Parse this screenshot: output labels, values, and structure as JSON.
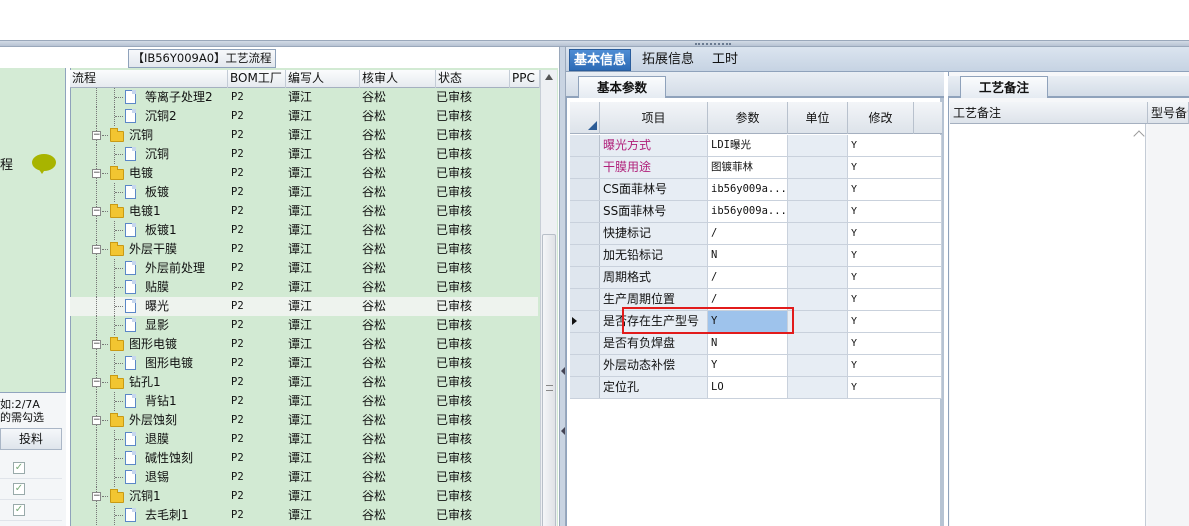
{
  "left_panel": {
    "flow_label": "程",
    "note_line1": " 如:2/7A",
    "note_line2": "的需勾选",
    "column_header": "投料",
    "checkbox_mark": "✓"
  },
  "process_panel": {
    "title": "【IB56Y009A0】工艺流程",
    "columns": [
      "流程",
      "BOM工厂",
      "编写人",
      "核审人",
      "状态",
      "PPC"
    ],
    "rows": [
      {
        "name": "等离子处理2",
        "level": 2,
        "type": "doc",
        "bom": "P2",
        "writer": "谭江",
        "reviewer": "谷松",
        "status": "已审核"
      },
      {
        "name": "沉铜2",
        "level": 2,
        "type": "doc",
        "bom": "P2",
        "writer": "谭江",
        "reviewer": "谷松",
        "status": "已审核"
      },
      {
        "name": "沉铜",
        "level": 1,
        "type": "folder",
        "bom": "P2",
        "writer": "谭江",
        "reviewer": "谷松",
        "status": "已审核"
      },
      {
        "name": "沉铜",
        "level": 2,
        "type": "doc",
        "bom": "P2",
        "writer": "谭江",
        "reviewer": "谷松",
        "status": "已审核"
      },
      {
        "name": "电镀",
        "level": 1,
        "type": "folder",
        "bom": "P2",
        "writer": "谭江",
        "reviewer": "谷松",
        "status": "已审核"
      },
      {
        "name": "板镀",
        "level": 2,
        "type": "doc",
        "bom": "P2",
        "writer": "谭江",
        "reviewer": "谷松",
        "status": "已审核"
      },
      {
        "name": "电镀1",
        "level": 1,
        "type": "folder",
        "bom": "P2",
        "writer": "谭江",
        "reviewer": "谷松",
        "status": "已审核"
      },
      {
        "name": "板镀1",
        "level": 2,
        "type": "doc",
        "bom": "P2",
        "writer": "谭江",
        "reviewer": "谷松",
        "status": "已审核"
      },
      {
        "name": "外层干膜",
        "level": 1,
        "type": "folder",
        "bom": "P2",
        "writer": "谭江",
        "reviewer": "谷松",
        "status": "已审核"
      },
      {
        "name": "外层前处理",
        "level": 2,
        "type": "doc",
        "bom": "P2",
        "writer": "谭江",
        "reviewer": "谷松",
        "status": "已审核"
      },
      {
        "name": "贴膜",
        "level": 2,
        "type": "doc",
        "bom": "P2",
        "writer": "谭江",
        "reviewer": "谷松",
        "status": "已审核"
      },
      {
        "name": "曝光",
        "level": 2,
        "type": "doc",
        "bom": "P2",
        "writer": "谭江",
        "reviewer": "谷松",
        "status": "已审核",
        "selected": true
      },
      {
        "name": "显影",
        "level": 2,
        "type": "doc",
        "bom": "P2",
        "writer": "谭江",
        "reviewer": "谷松",
        "status": "已审核"
      },
      {
        "name": "图形电镀",
        "level": 1,
        "type": "folder",
        "bom": "P2",
        "writer": "谭江",
        "reviewer": "谷松",
        "status": "已审核"
      },
      {
        "name": "图形电镀",
        "level": 2,
        "type": "doc",
        "bom": "P2",
        "writer": "谭江",
        "reviewer": "谷松",
        "status": "已审核"
      },
      {
        "name": "钻孔1",
        "level": 1,
        "type": "folder",
        "bom": "P2",
        "writer": "谭江",
        "reviewer": "谷松",
        "status": "已审核"
      },
      {
        "name": "背钻1",
        "level": 2,
        "type": "doc",
        "bom": "P2",
        "writer": "谭江",
        "reviewer": "谷松",
        "status": "已审核"
      },
      {
        "name": "外层蚀刻",
        "level": 1,
        "type": "folder",
        "bom": "P2",
        "writer": "谭江",
        "reviewer": "谷松",
        "status": "已审核"
      },
      {
        "name": "退膜",
        "level": 2,
        "type": "doc",
        "bom": "P2",
        "writer": "谭江",
        "reviewer": "谷松",
        "status": "已审核"
      },
      {
        "name": "碱性蚀刻",
        "level": 2,
        "type": "doc",
        "bom": "P2",
        "writer": "谭江",
        "reviewer": "谷松",
        "status": "已审核"
      },
      {
        "name": "退锡",
        "level": 2,
        "type": "doc",
        "bom": "P2",
        "writer": "谭江",
        "reviewer": "谷松",
        "status": "已审核"
      },
      {
        "name": "沉铜1",
        "level": 1,
        "type": "folder",
        "bom": "P2",
        "writer": "谭江",
        "reviewer": "谷松",
        "status": "已审核"
      },
      {
        "name": "去毛刺1",
        "level": 2,
        "type": "doc",
        "bom": "P2",
        "writer": "谭江",
        "reviewer": "谷松",
        "status": "已审核"
      }
    ]
  },
  "tabs": [
    "基本信息",
    "拓展信息",
    "工时"
  ],
  "basic_params": {
    "subtab": "基本参数",
    "columns": [
      "项目",
      "参数",
      "单位",
      "修改"
    ],
    "rows": [
      {
        "item": "曝光方式",
        "param": "LDI曝光",
        "unit": "",
        "modify": "Y",
        "highlight_color": "#b0207a"
      },
      {
        "item": "干膜用途",
        "param": "图镀菲林",
        "unit": "",
        "modify": "Y",
        "highlight_color": "#b0207a"
      },
      {
        "item": "CS面菲林号",
        "param": "ib56y009a...",
        "unit": "",
        "modify": "Y"
      },
      {
        "item": "SS面菲林号",
        "param": "ib56y009a...",
        "unit": "",
        "modify": "Y"
      },
      {
        "item": "快捷标记",
        "param": "/",
        "unit": "",
        "modify": "Y"
      },
      {
        "item": "加无铅标记",
        "param": "N",
        "unit": "",
        "modify": "Y"
      },
      {
        "item": "周期格式",
        "param": "/",
        "unit": "",
        "modify": "Y"
      },
      {
        "item": "生产周期位置",
        "param": "/",
        "unit": "",
        "modify": "Y"
      },
      {
        "item": "是否存在生产型号",
        "param": "Y",
        "unit": "",
        "modify": "Y",
        "current": true
      },
      {
        "item": "是否有负焊盘",
        "param": "N",
        "unit": "",
        "modify": "Y"
      },
      {
        "item": "外层动态补偿",
        "param": "Y",
        "unit": "",
        "modify": "Y"
      },
      {
        "item": "定位孔",
        "param": "LO",
        "unit": "",
        "modify": "Y"
      }
    ]
  },
  "process_notes": {
    "subtab": "工艺备注",
    "col1": "工艺备注",
    "col2": "型号备注"
  },
  "colors": {
    "green_panel": "#d2ead3",
    "tab_active": "#2c6bb6",
    "highlight_text": "#b0207a",
    "callout_red": "#e21b1b"
  }
}
